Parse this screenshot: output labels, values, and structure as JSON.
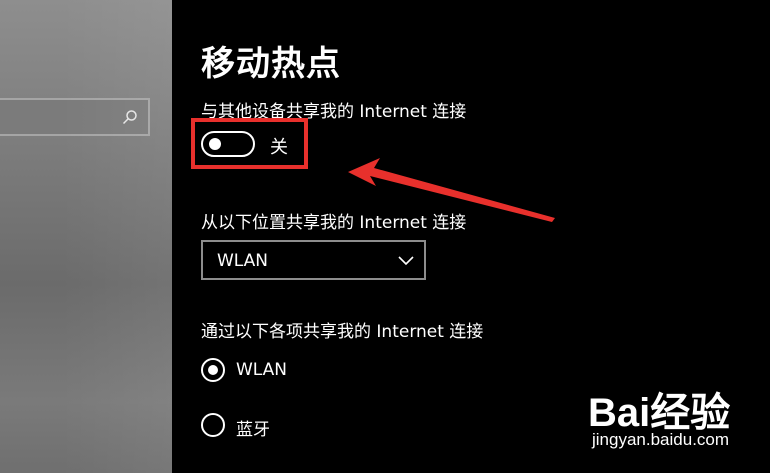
{
  "page": {
    "title": "移动热点"
  },
  "share_connection": {
    "label": "与其他设备共享我的 Internet 连接",
    "toggle_state": "关",
    "toggle_on": false
  },
  "share_from": {
    "label": "从以下位置共享我的 Internet 连接",
    "selected": "WLAN"
  },
  "share_via": {
    "label": "通过以下各项共享我的 Internet 连接",
    "options": [
      {
        "label": "WLAN",
        "checked": true
      },
      {
        "label": "蓝牙",
        "checked": false
      }
    ]
  },
  "annotation": {
    "highlight_color": "#e8302c"
  },
  "watermark": {
    "logo": "Bai经验",
    "url": "jingyan.baidu.com"
  }
}
